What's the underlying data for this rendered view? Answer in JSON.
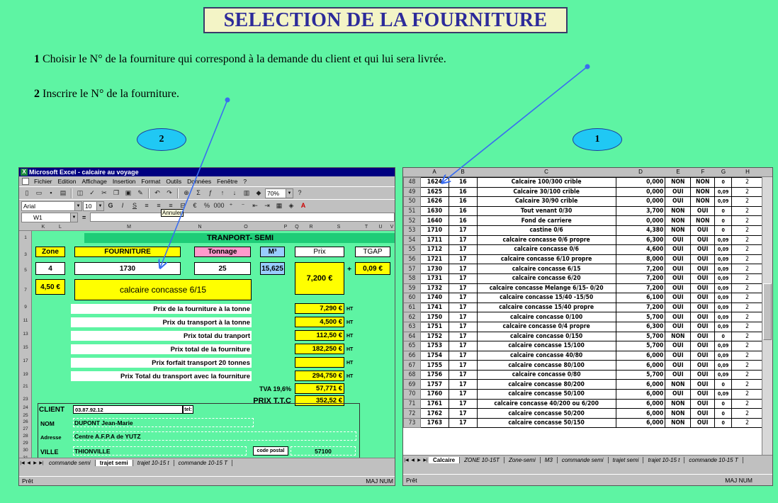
{
  "title": "SELECTION DE LA FOURNITURE",
  "instructions": [
    {
      "num": "1",
      "text": "Choisir le N° de la fourniture qui correspond à la demande du client et qui lui sera livrée."
    },
    {
      "num": "2",
      "text": "Inscrire le N° de la fourniture."
    }
  ],
  "callouts": {
    "left": "2",
    "right": "1"
  },
  "colors": {
    "background": "#5ef4a3",
    "callout": "#20c8f4",
    "arrow": "#3a6df0",
    "title_text": "#2d2b9a"
  },
  "left_window": {
    "title": "Microsoft Excel - calcaire au voyage",
    "menu": [
      "Fichier",
      "Edition",
      "Affichage",
      "Insertion",
      "Format",
      "Outils",
      "Données",
      "Fenêtre",
      "?"
    ],
    "zoom": "70%",
    "font": "Arial",
    "font_size": "10",
    "tooltip": "Annuler",
    "name_box": "W1",
    "formula_eq": "=",
    "col_headers": [
      "K",
      "L",
      "M",
      "N",
      "O",
      "P",
      "Q",
      "R",
      "S",
      "T",
      "U",
      "V"
    ],
    "sheet": {
      "header": "TRANPORT- SEMI",
      "labels": {
        "zone": "Zone",
        "fourniture": "FOURNITURE",
        "tonnage": "Tonnage",
        "m3": "M³",
        "prix": "Prix",
        "tgap": "TGAP"
      },
      "values": {
        "zone": "4",
        "fourniture": "1730",
        "tonnage": "25",
        "m3": "15,625",
        "prix": "7,200 €",
        "plus": "+",
        "tgap": "0,09 €",
        "zone_price": "4,50 €",
        "description": "calcaire concasse  6/15"
      },
      "lines": [
        {
          "label": "Prix de la fourniture à la tonne",
          "value": "7,290 €",
          "unit": "HT"
        },
        {
          "label": "Prix du transport à la tonne",
          "value": "4,500 €",
          "unit": "HT"
        },
        {
          "label": "Prix total du tranport",
          "value": "112,50 €",
          "unit": "HT"
        },
        {
          "label": "Prix total de la fourniture",
          "value": "182,250 €",
          "unit": "HT"
        },
        {
          "label": "Prix forfait transport 20 tonnes",
          "value": "",
          "unit": "HT"
        },
        {
          "label": "Prix Total du transport avec la fourniture",
          "value": "294,750 €",
          "unit": "HT"
        }
      ],
      "tva_label": "TVA 19,6%",
      "tva_value": "57,771 €",
      "ttc_label": "PRIX T.T.C",
      "ttc_value": "352,52 €",
      "client": {
        "title": "CLIENT",
        "phone": "03.87.92.12",
        "tel_label": "tel:",
        "nom_label": "NOM",
        "nom": "DUPONT  Jean-Marie",
        "adresse_label": "Adresse",
        "adresse": "Centre A.F.P.A de YUTZ",
        "ville_label": "VILLE",
        "ville": "THIONVILLE",
        "cp_label": "code postal",
        "cp": "57100"
      },
      "row_numbers": [
        "1",
        "3",
        "5",
        "7",
        "9",
        "11",
        "13",
        "15",
        "17",
        "19",
        "21",
        "23",
        "24",
        "25",
        "26",
        "27",
        "28",
        "29",
        "30",
        "31"
      ]
    },
    "tabs": [
      "commande semi",
      "trajet semi",
      "trajet 10-15 t",
      "commande 10-15 T"
    ],
    "active_tab": "trajet semi",
    "status": "Prêt",
    "status_right": "MAJ NUM"
  },
  "right_window": {
    "col_headers": [
      "A",
      "B",
      "C",
      "D",
      "E",
      "F",
      "G",
      "H"
    ],
    "rows": [
      [
        "48",
        "1624",
        "16",
        "Calcaire 100/300 crible",
        "0,000",
        "NON",
        "NON",
        "0",
        "2"
      ],
      [
        "49",
        "1625",
        "16",
        "Calcaire 30/100 crible",
        "0,000",
        "OUI",
        "NON",
        "0,09",
        "2"
      ],
      [
        "50",
        "1626",
        "16",
        "Calcaire 30/90 crible",
        "0,000",
        "OUI",
        "NON",
        "0,09",
        "2"
      ],
      [
        "51",
        "1630",
        "16",
        "Tout venant 0/30",
        "3,700",
        "NON",
        "OUI",
        "0",
        "2"
      ],
      [
        "52",
        "1640",
        "16",
        "Fond de carriere",
        "0,000",
        "NON",
        "NON",
        "0",
        "2"
      ],
      [
        "53",
        "1710",
        "17",
        "castine 0/6",
        "4,380",
        "NON",
        "OUI",
        "0",
        "2"
      ],
      [
        "54",
        "1711",
        "17",
        "calcaire concasse  0/6 propre",
        "6,300",
        "OUI",
        "OUI",
        "0,09",
        "2"
      ],
      [
        "55",
        "1712",
        "17",
        "calcaire concasse  0/6",
        "4,600",
        "OUI",
        "OUI",
        "0,09",
        "2"
      ],
      [
        "56",
        "1721",
        "17",
        "calcaire concasse  6/10 propre",
        "8,000",
        "OUI",
        "OUI",
        "0,09",
        "2"
      ],
      [
        "57",
        "1730",
        "17",
        "calcaire concasse  6/15",
        "7,200",
        "OUI",
        "OUI",
        "0,09",
        "2"
      ],
      [
        "58",
        "1731",
        "17",
        "calcaire concasse  6/20",
        "7,200",
        "OUI",
        "OUI",
        "0,09",
        "2"
      ],
      [
        "59",
        "1732",
        "17",
        "calcaire concasse  Melange 6/15- 0/20",
        "7,200",
        "OUI",
        "OUI",
        "0,09",
        "2"
      ],
      [
        "60",
        "1740",
        "17",
        "calcaire concasse  15/40 -15/50",
        "6,100",
        "OUI",
        "OUI",
        "0,09",
        "2"
      ],
      [
        "61",
        "1741",
        "17",
        "calcaire concasse  15/40 propre",
        "7,200",
        "OUI",
        "OUI",
        "0,09",
        "2"
      ],
      [
        "62",
        "1750",
        "17",
        "calcaire concasse  0/100",
        "5,700",
        "OUI",
        "OUI",
        "0,09",
        "2"
      ],
      [
        "63",
        "1751",
        "17",
        "calcaire concasse  0/4 propre",
        "6,300",
        "OUI",
        "OUI",
        "0,09",
        "2"
      ],
      [
        "64",
        "1752",
        "17",
        "calcaire concasse  0/150",
        "5,700",
        "NON",
        "OUI",
        "0",
        "2"
      ],
      [
        "65",
        "1753",
        "17",
        "calcaire concasse  15/100",
        "5,700",
        "OUI",
        "OUI",
        "0,09",
        "2"
      ],
      [
        "66",
        "1754",
        "17",
        "calcaire concasse  40/80",
        "6,000",
        "OUI",
        "OUI",
        "0,09",
        "2"
      ],
      [
        "67",
        "1755",
        "17",
        "calcaire concasse  80/100",
        "6,000",
        "OUI",
        "OUI",
        "0,09",
        "2"
      ],
      [
        "68",
        "1756",
        "17",
        "calcaire concasse  0/80",
        "5,700",
        "OUI",
        "OUI",
        "0,09",
        "2"
      ],
      [
        "69",
        "1757",
        "17",
        "calcaire concasse  80/200",
        "6,000",
        "NON",
        "OUI",
        "0",
        "2"
      ],
      [
        "70",
        "1760",
        "17",
        "calcaire concasse  50/100",
        "6,000",
        "OUI",
        "OUI",
        "0,09",
        "2"
      ],
      [
        "71",
        "1761",
        "17",
        "calcaire concasse  40/200 ou 6/200",
        "6,000",
        "NON",
        "OUI",
        "0",
        "2"
      ],
      [
        "72",
        "1762",
        "17",
        "calcaire concasse  50/200",
        "6,000",
        "NON",
        "OUI",
        "0",
        "2"
      ],
      [
        "73",
        "1763",
        "17",
        "calcaire concasse  50/150",
        "6,000",
        "NON",
        "OUI",
        "0",
        "2"
      ]
    ],
    "tabs": [
      "Calcaire",
      "ZONE 10-15T",
      "Zone-semi",
      "M3",
      "commande semi",
      "trajet semi",
      "trajet 10-15 t",
      "commande 10-15 T"
    ],
    "active_tab": "Calcaire",
    "status": "Prêt",
    "status_right": "MAJ NUM"
  }
}
